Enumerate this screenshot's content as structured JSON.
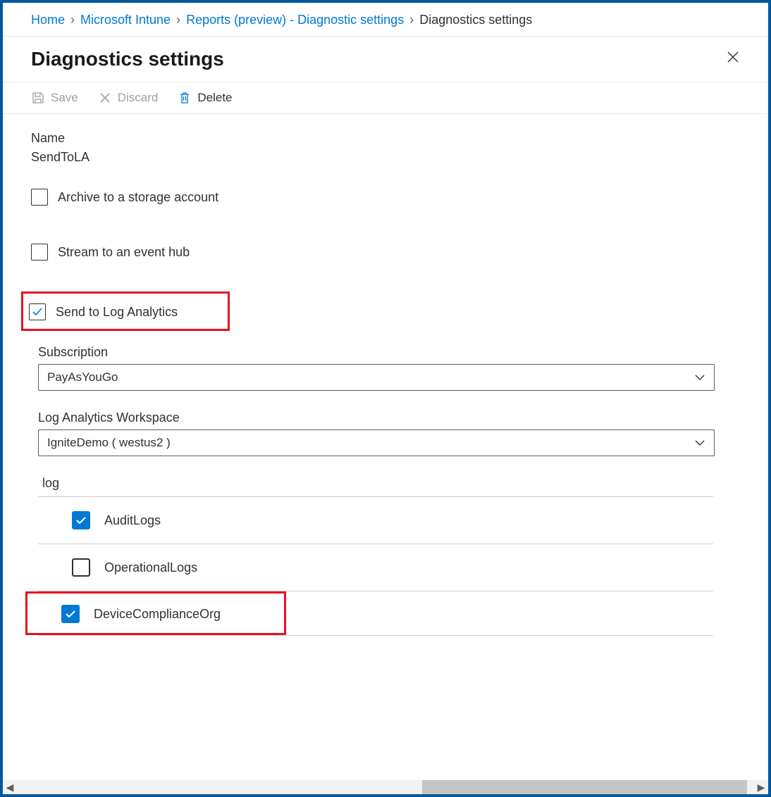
{
  "breadcrumb": {
    "items": [
      {
        "label": "Home",
        "link": true
      },
      {
        "label": "Microsoft Intune",
        "link": true
      },
      {
        "label": "Reports (preview) - Diagnostic settings",
        "link": true
      },
      {
        "label": "Diagnostics settings",
        "link": false
      }
    ]
  },
  "page": {
    "title": "Diagnostics settings"
  },
  "toolbar": {
    "save": "Save",
    "discard": "Discard",
    "delete": "Delete"
  },
  "form": {
    "name_label": "Name",
    "name_value": "SendToLA",
    "archive_label": "Archive to a storage account",
    "archive_checked": false,
    "stream_label": "Stream to an event hub",
    "stream_checked": false,
    "sendla_label": "Send to Log Analytics",
    "sendla_checked": true,
    "subscription_label": "Subscription",
    "subscription_value": "PayAsYouGo",
    "workspace_label": "Log Analytics Workspace",
    "workspace_value": "IgniteDemo ( westus2 )",
    "log_header": "log",
    "logs": [
      {
        "label": "AuditLogs",
        "checked": true
      },
      {
        "label": "OperationalLogs",
        "checked": false
      },
      {
        "label": "DeviceComplianceOrg",
        "checked": true
      }
    ]
  }
}
